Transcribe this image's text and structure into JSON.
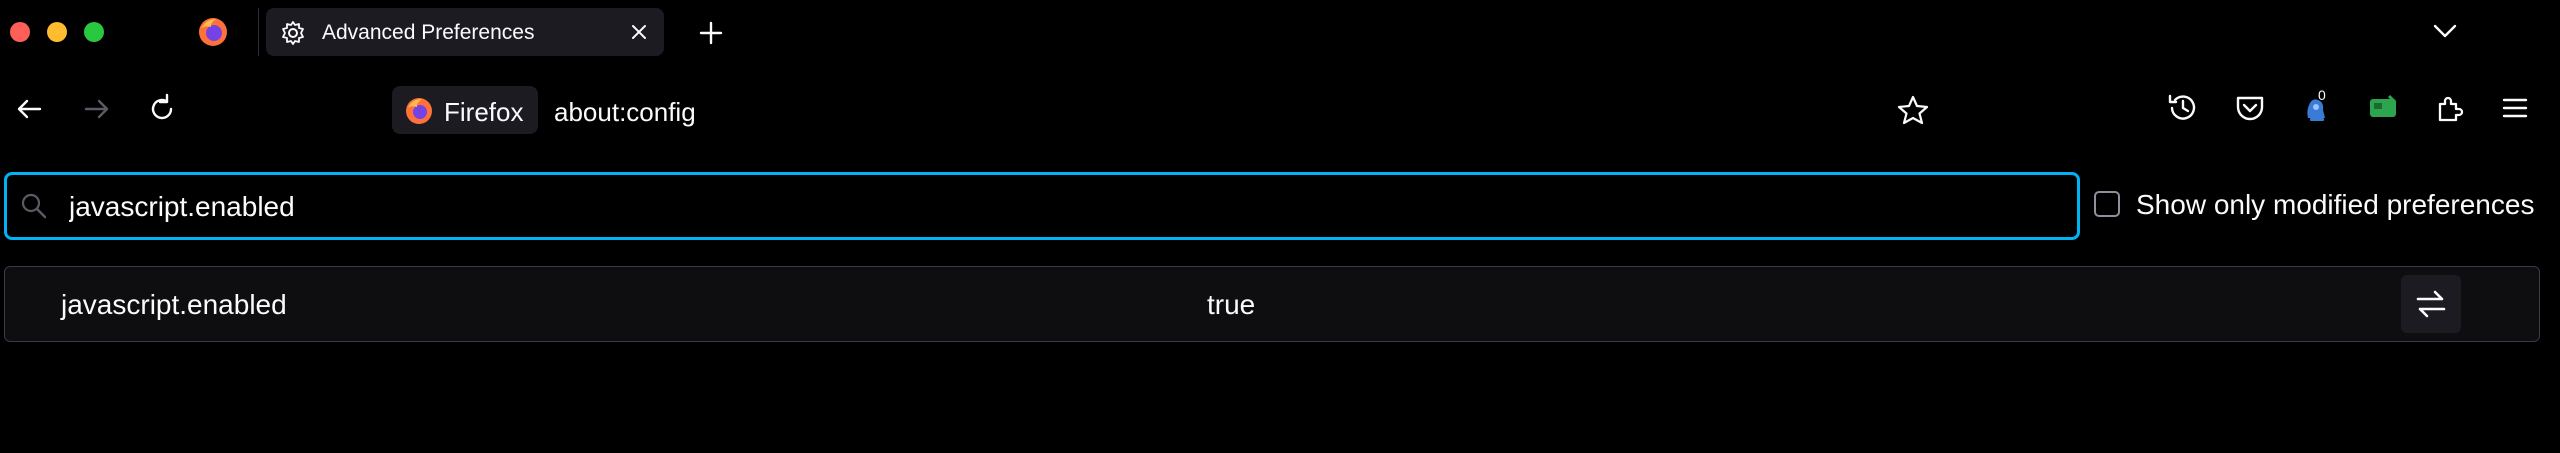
{
  "tab": {
    "title": "Advanced Preferences"
  },
  "urlbar": {
    "identity_label": "Firefox",
    "url": "about:config"
  },
  "toolbar": {
    "notification_count": "0"
  },
  "search": {
    "value": "javascript.enabled",
    "placeholder": ""
  },
  "filter": {
    "show_modified_label": "Show only modified preferences",
    "checked": false
  },
  "preferences": [
    {
      "name": "javascript.enabled",
      "value": "true"
    }
  ],
  "colors": {
    "accent": "#00b3f4",
    "background": "#000000",
    "tab_background": "#1c1b22",
    "text": "#fbfbfe",
    "traffic_red": "#ff5f57",
    "traffic_yellow": "#febc2e",
    "traffic_green": "#28c840"
  },
  "icons": {
    "window_controls": [
      "close-window-icon",
      "minimize-window-icon",
      "zoom-window-icon"
    ],
    "pinned_tab": "firefox-logo-icon",
    "tab": "gear-icon",
    "nav": [
      "back-arrow-icon",
      "forward-arrow-icon",
      "reload-icon"
    ],
    "toolbar": [
      "history-icon",
      "pocket-icon",
      "notification-extension-icon",
      "green-extension-icon",
      "extensions-puzzle-icon",
      "hamburger-menu-icon"
    ],
    "row_action": "toggle-arrows-icon"
  }
}
